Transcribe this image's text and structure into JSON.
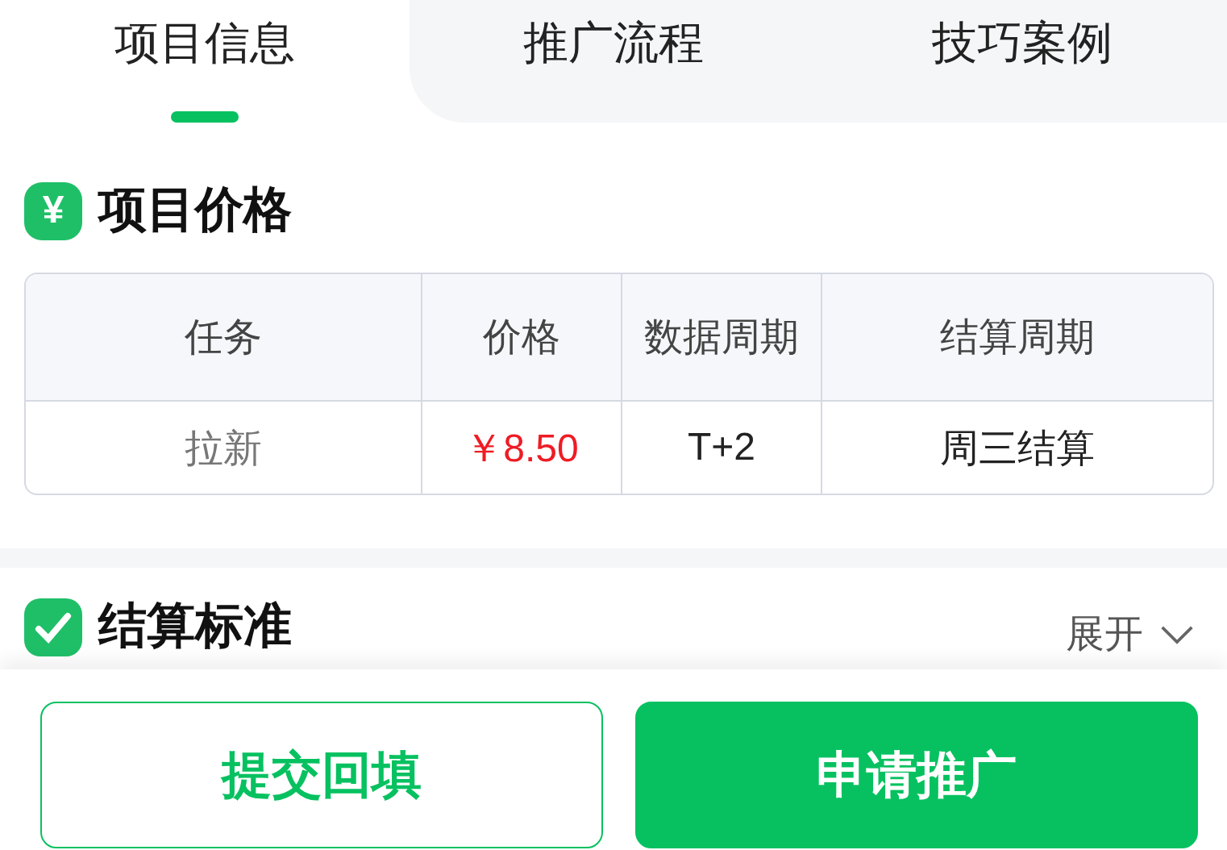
{
  "tabs": [
    {
      "label": "项目信息",
      "selected": true
    },
    {
      "label": "推广流程",
      "selected": false
    },
    {
      "label": "技巧案例",
      "selected": false
    }
  ],
  "price_section": {
    "icon_text": "¥",
    "title": "项目价格",
    "table": {
      "columns": [
        "任务",
        "价格",
        "数据周期",
        "结算周期"
      ],
      "rows": [
        [
          "拉新",
          "￥8.50",
          "T+2",
          "周三结算"
        ]
      ]
    }
  },
  "standard_section": {
    "title": "结算标准",
    "toggle": "展开",
    "expanded": false
  },
  "buttons": [
    {
      "label": "提交回填",
      "kind": "outline"
    },
    {
      "label": "申请推广",
      "kind": "primary"
    }
  ]
}
